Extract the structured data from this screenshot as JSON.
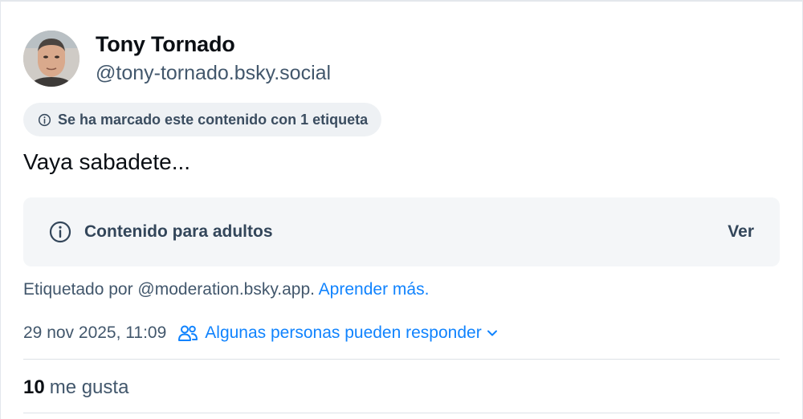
{
  "author": {
    "display_name": "Tony Tornado",
    "handle": "@tony-tornado.bsky.social",
    "avatar_icon": "user-avatar-photo"
  },
  "label_pill": {
    "icon": "info-circle-icon",
    "text": "Se ha marcado este contenido con 1 etiqueta"
  },
  "post": {
    "text": "Vaya sabadete..."
  },
  "content_warning": {
    "icon": "info-circle-icon",
    "label": "Contenido para adultos",
    "show_button": "Ver"
  },
  "moderation": {
    "labeled_by": "Etiquetado por @moderation.bsky.app.",
    "learn_more": "Aprender más."
  },
  "meta": {
    "timestamp": "29 nov 2025, 11:09",
    "reply_setting": "Algunas personas pueden responder",
    "reply_icon": "people-icon",
    "chevron_icon": "chevron-down-icon"
  },
  "stats": {
    "likes_count": "10",
    "likes_label": "me gusta"
  },
  "colors": {
    "link": "#1083fe",
    "muted_text": "#42576c",
    "pill_bg": "#eef1f4",
    "warning_bg": "#f4f6f8"
  }
}
